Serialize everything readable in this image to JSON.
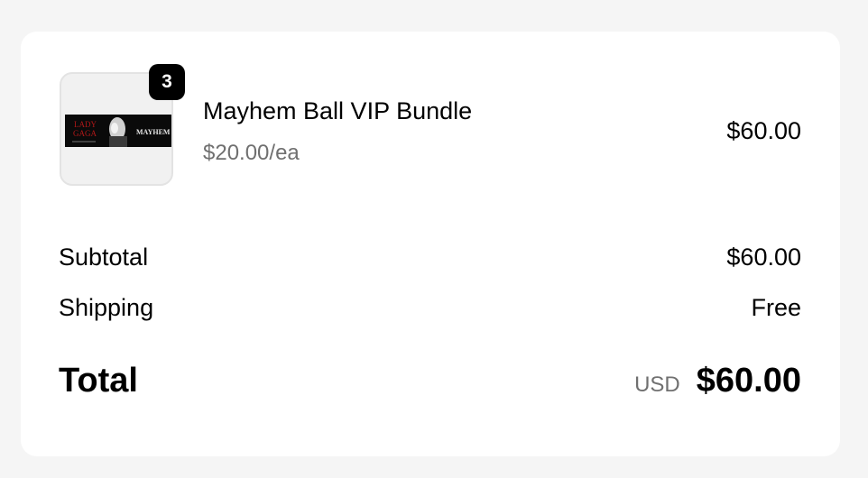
{
  "product": {
    "name": "Mayhem Ball VIP Bundle",
    "unit_price": "$20.00/ea",
    "quantity": "3",
    "line_total": "$60.00",
    "image_text_left_1": "LADY",
    "image_text_left_2": "GAGA",
    "image_text_right": "MAYHEM"
  },
  "summary": {
    "subtotal_label": "Subtotal",
    "subtotal_value": "$60.00",
    "shipping_label": "Shipping",
    "shipping_value": "Free",
    "total_label": "Total",
    "currency": "USD",
    "total_value": "$60.00"
  },
  "colors": {
    "background": "#f5f5f5",
    "card": "#ffffff",
    "muted_text": "#707070",
    "badge": "#000000"
  }
}
